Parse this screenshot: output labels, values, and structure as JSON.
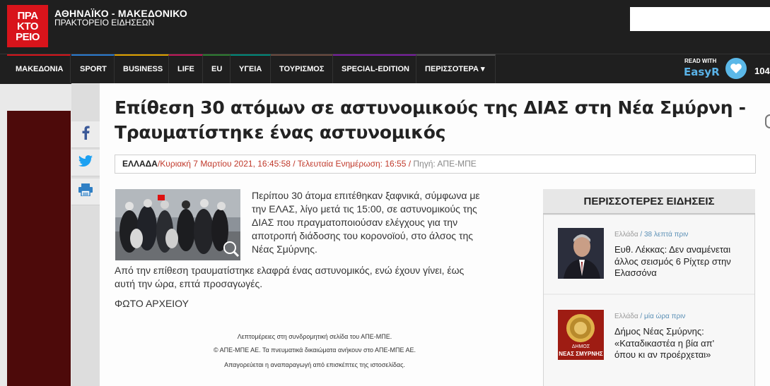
{
  "header": {
    "logo_lines": [
      "ΠΡΑ",
      "ΚΤΟ",
      "ΡΕΙΟ"
    ],
    "title": "ΑΘΗΝΑΪΚΟ - ΜΑΚΕΔΟΝΙΚΟ",
    "subtitle": "ΠΡΑΚΤΟΡΕΙΟ ΕΙΔΗΣΕΩΝ",
    "search_placeholder": "",
    "brand_color": "#d8141b"
  },
  "nav": {
    "items": [
      "ΜΑΚΕΔΟΝΙΑ",
      "SPORT",
      "BUSINESS",
      "LIFE",
      "EU",
      "ΥΓΕΙΑ",
      "ΤΟΥΡΙΣΜΟΣ",
      "SPECIAL-EDITION",
      "ΠΕΡΙΣΣΟΤΕΡΑ ▾"
    ],
    "read_with": "READ WITH",
    "easy_reader": "EasyR",
    "number_partial": "104"
  },
  "share": {
    "icons": [
      "facebook-icon",
      "twitter-icon",
      "print-icon"
    ]
  },
  "article": {
    "headline": "Επίθεση 30 ατόμων σε αστυνομικούς της ΔΙΑΣ στη Νέα Σμύρνη - Τραυματίστηκε ένας αστυνομικός",
    "category": "ΕΛΛΑΔΑ",
    "meta": "/Κυριακή 7 Μαρτίου 2021, 16:45:58 / Τελευταία Ενημέρωση: 16:55 /",
    "source": " Πηγή: ΑΠΕ-ΜΠΕ",
    "lead_lines": [
      "Περίπου 30 άτομα επιτέθηκαν ξαφνικά, σύμφωνα με",
      "την ΕΛΑΣ, λίγο μετά τις 15:00, σε αστυνομικούς της",
      "ΔΙΑΣ που πραγματοποιούσαν ελέγχους για την",
      "αποτροπή διάδοσης του κορονοϊού, στο άλσος της",
      "Νέας Σμύρνης."
    ],
    "para2_lines": [
      "Από την επίθεση τραυματίστηκε ελαφρά ένας αστυνομικός, ενώ έχουν γίνει, έως",
      "αυτή την ώρα, επτά προσαγωγές."
    ],
    "photo_caption": "ΦΩΤΟ ΑΡΧΕΙΟΥ",
    "credit_lines": [
      "Λεπτομέρειες στη συνδρομητική σελίδα του ΑΠΕ-ΜΠΕ.",
      "© ΑΠΕ-ΜΠΕ ΑΕ. Τα πνευματικά δικαιώματα ανήκουν στο ΑΠΕ-ΜΠΕ ΑΕ.",
      "Απαγορεύεται η αναπαραγωγή από επισκέπτες της ιστοσελίδας."
    ]
  },
  "sidebar": {
    "title": "ΠΕΡΙΣΣΟΤΕΡΕΣ ΕΙΔΗΣΕΙΣ",
    "items": [
      {
        "category": "Ελλάδα",
        "ago": " / 38 λεπτά πριν",
        "title_lines": [
          "Ευθ. Λέκκας: Δεν αναμένεται",
          "άλλος σεισμός 6 Ρίχτερ στην",
          "Ελασσόνα"
        ]
      },
      {
        "category": "Ελλάδα",
        "ago": " / μία ώρα πριν",
        "title_lines": [
          "Δήμος Νέας Σμύρνης:",
          "«Καταδικαστέα η βία απ'",
          "όπου κι αν προέρχεται»"
        ],
        "thumb_text": [
          "ΔΗΜΟΣ",
          "ΝΕΑΣ ΣΜΥΡΝΗΣ"
        ]
      }
    ]
  }
}
